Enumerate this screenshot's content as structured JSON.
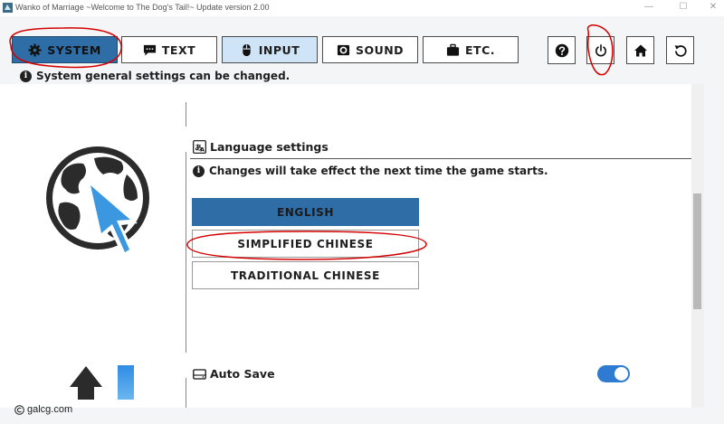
{
  "window": {
    "title": "Wanko of Marriage ~Welcome to The Dog's Tail!~ Update version 2.00",
    "minimize_glyph": "—",
    "maximize_glyph": "☐",
    "close_glyph": "✕"
  },
  "tabs": [
    {
      "label": "SYSTEM",
      "icon": "gear-icon",
      "state": "active"
    },
    {
      "label": "TEXT",
      "icon": "speech-bubble-icon",
      "state": "normal"
    },
    {
      "label": "INPUT",
      "icon": "mouse-icon",
      "state": "hover"
    },
    {
      "label": "SOUND",
      "icon": "speaker-icon",
      "state": "normal"
    },
    {
      "label": "ETC.",
      "icon": "briefcase-icon",
      "state": "normal"
    }
  ],
  "toolbar_icons": [
    "help-icon",
    "power-icon",
    "home-icon",
    "back-icon"
  ],
  "description": "System general settings can be changed.",
  "language_section": {
    "title": "Language settings",
    "note": "Changes will take effect the next time the game starts.",
    "options": [
      "ENGLISH",
      "SIMPLIFIED CHINESE",
      "TRADITIONAL CHINESE"
    ],
    "selected": "ENGLISH"
  },
  "auto_save": {
    "label": "Auto Save",
    "enabled": true
  },
  "watermark": "galcg.com",
  "colors": {
    "accent": "#2e6da6",
    "tab_hover": "#cfe4f7",
    "toggle_on": "#2e7bd1",
    "annotation": "#d40000"
  }
}
